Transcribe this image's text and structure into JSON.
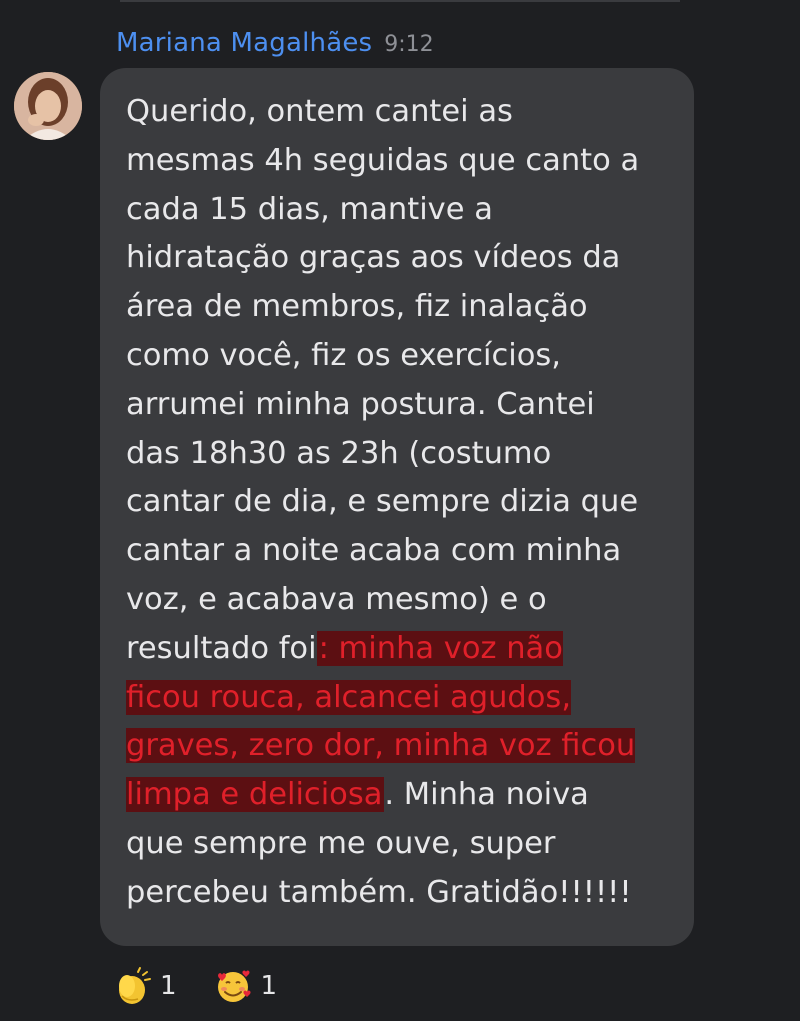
{
  "message": {
    "author": "Mariana Magalhães",
    "time": "9:12",
    "text_before": "Querido, ontem cantei as\nmesmas 4h seguidas que canto a\ncada 15 dias, mantive a\nhidratação graças aos vídeos da\nárea de membros, fiz inalação\ncomo você, fiz os exercícios,\narrumei minha postura. Cantei\ndas 18h30 as 23h (costumo\ncantar de dia, e sempre dizia que\ncantar a noite acaba com minha\nvoz, e acabava mesmo) e o\nresultado foi",
    "text_highlight": ": minha voz não\nficou rouca, alcancei agudos,\ngraves, zero dor, minha voz ficou\nlimpa e deliciosa",
    "text_after": ". Minha noiva\nque sempre me ouve, super\npercebeu também. Gratidão!!!!!!",
    "highlight_color": "#e0202a"
  },
  "reactions": [
    {
      "icon": "clapping-hands-icon",
      "count": "1"
    },
    {
      "icon": "smiling-face-with-hearts-icon",
      "count": "1"
    }
  ]
}
